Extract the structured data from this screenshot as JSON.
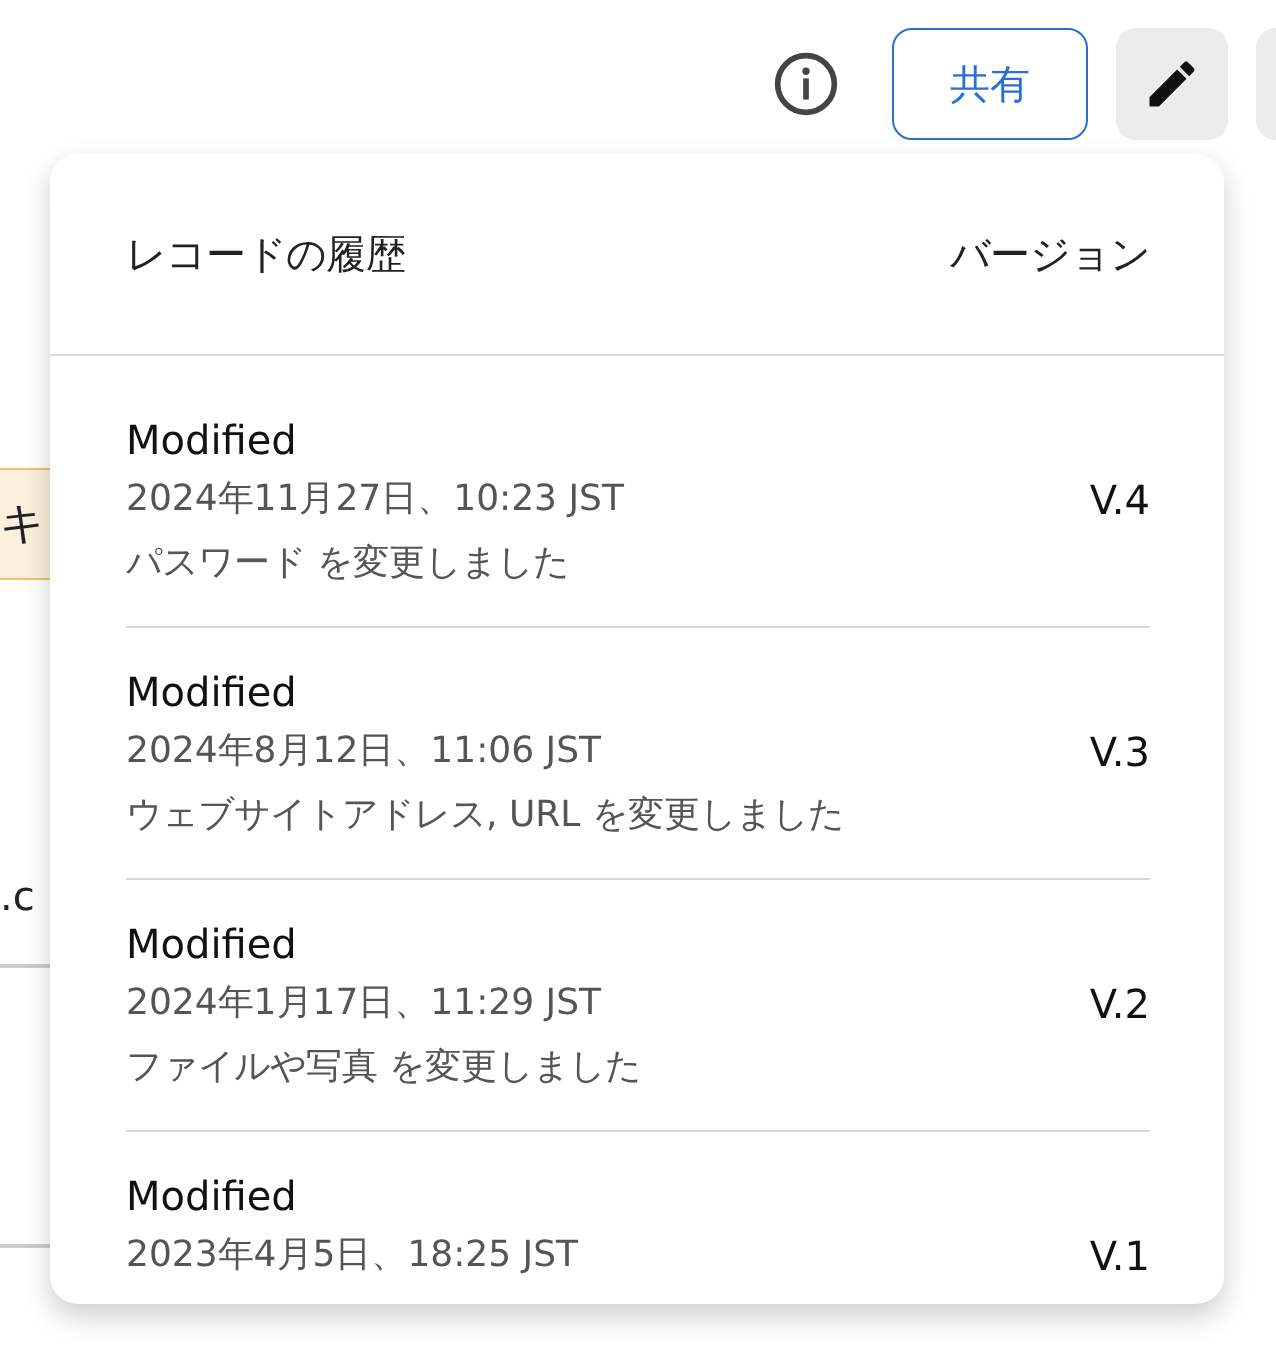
{
  "toolbar": {
    "share_button": "共有"
  },
  "background": {
    "banner_text": "キ",
    "field_text": ".c"
  },
  "history_popup": {
    "title": "レコードの履歴",
    "version_heading": "バージョン",
    "entries": [
      {
        "action": "Modified",
        "timestamp": "2024年11月27日、10:23 JST",
        "version": "V.4",
        "change": "パスワード を変更しました"
      },
      {
        "action": "Modified",
        "timestamp": "2024年8月12日、11:06 JST",
        "version": "V.3",
        "change": "ウェブサイトアドレス, URL を変更しました"
      },
      {
        "action": "Modified",
        "timestamp": "2024年1月17日、11:29 JST",
        "version": "V.2",
        "change": "ファイルや写真 を変更しました"
      },
      {
        "action": "Modified",
        "timestamp": "2023年4月5日、18:25 JST",
        "version": "V.1"
      }
    ]
  }
}
